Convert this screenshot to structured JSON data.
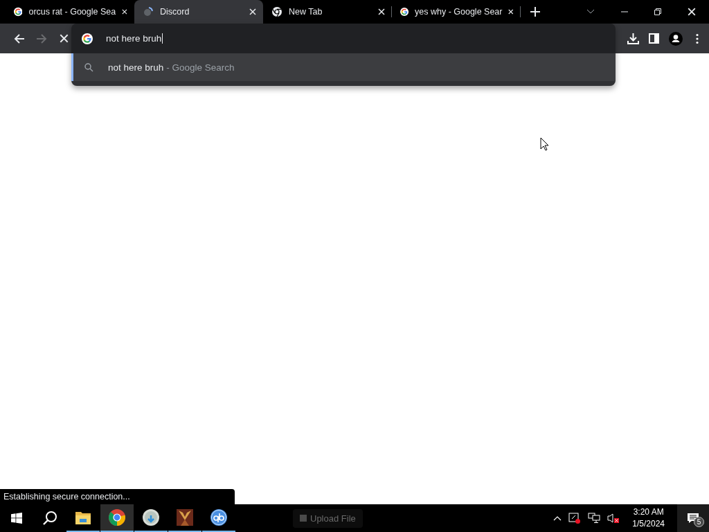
{
  "tabs": [
    {
      "title": "orcus rat - Google Sea",
      "kind": "google",
      "selected": false
    },
    {
      "title": "Discord",
      "kind": "loading",
      "selected": true
    },
    {
      "title": "New Tab",
      "kind": "chrome",
      "selected": false
    },
    {
      "title": "yes why - Google Sear",
      "kind": "google",
      "selected": false
    }
  ],
  "toolbar": {
    "forward_disabled": true,
    "loading": true
  },
  "omnibox": {
    "value": "not here bruh",
    "suggestions": [
      {
        "query": "not here bruh",
        "suffix": "- Google Search",
        "selected": true
      }
    ]
  },
  "status_bubble": "Establishing secure connection...",
  "taskbar": {
    "apps": [
      {
        "kind": "explorer",
        "running": true,
        "selected": false
      },
      {
        "kind": "chrome",
        "running": true,
        "selected": true
      },
      {
        "kind": "installer",
        "running": true,
        "selected": false
      },
      {
        "kind": "picture",
        "running": true,
        "selected": false
      },
      {
        "kind": "torrent",
        "running": true,
        "selected": false
      }
    ],
    "ghost_button": "Upload File",
    "time": "3:20 AM",
    "date": "1/5/2024",
    "notifications": "5"
  }
}
